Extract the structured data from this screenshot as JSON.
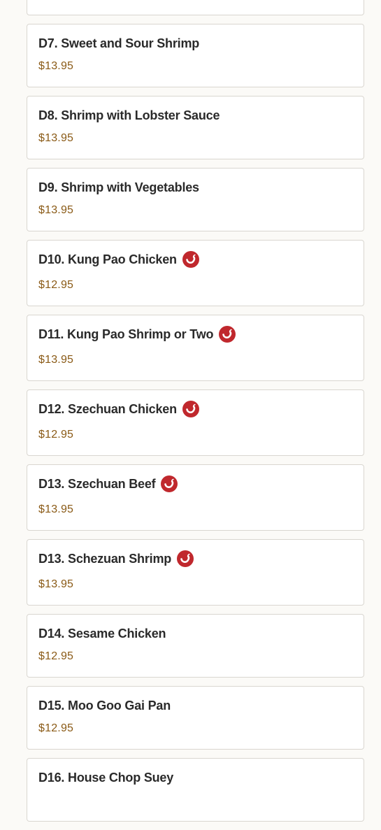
{
  "menu": {
    "items": [
      {
        "name": "",
        "price": "",
        "spicy": false
      },
      {
        "name": "D7. Sweet and Sour Shrimp",
        "price": "$13.95",
        "spicy": false
      },
      {
        "name": "D8. Shrimp with Lobster Sauce",
        "price": "$13.95",
        "spicy": false
      },
      {
        "name": "D9. Shrimp with Vegetables",
        "price": "$13.95",
        "spicy": false
      },
      {
        "name": "D10. Kung Pao Chicken",
        "price": "$12.95",
        "spicy": true
      },
      {
        "name": "D11. Kung Pao Shrimp or Two",
        "price": "$13.95",
        "spicy": true
      },
      {
        "name": "D12. Szechuan Chicken",
        "price": "$12.95",
        "spicy": true
      },
      {
        "name": "D13. Szechuan Beef",
        "price": "$13.95",
        "spicy": true
      },
      {
        "name": "D13. Schezuan Shrimp",
        "price": "$13.95",
        "spicy": true
      },
      {
        "name": "D14. Sesame Chicken",
        "price": "$12.95",
        "spicy": false
      },
      {
        "name": "D15. Moo Goo Gai Pan",
        "price": "$12.95",
        "spicy": false
      },
      {
        "name": "D16. House Chop Suey",
        "price": "",
        "spicy": false
      }
    ],
    "spicy_icon": "chili-pepper-icon",
    "colors": {
      "name": "#2a2a2a",
      "price": "#8a5a16",
      "spicy_badge": "#c0282d",
      "card_border": "#d9d6d0"
    }
  }
}
